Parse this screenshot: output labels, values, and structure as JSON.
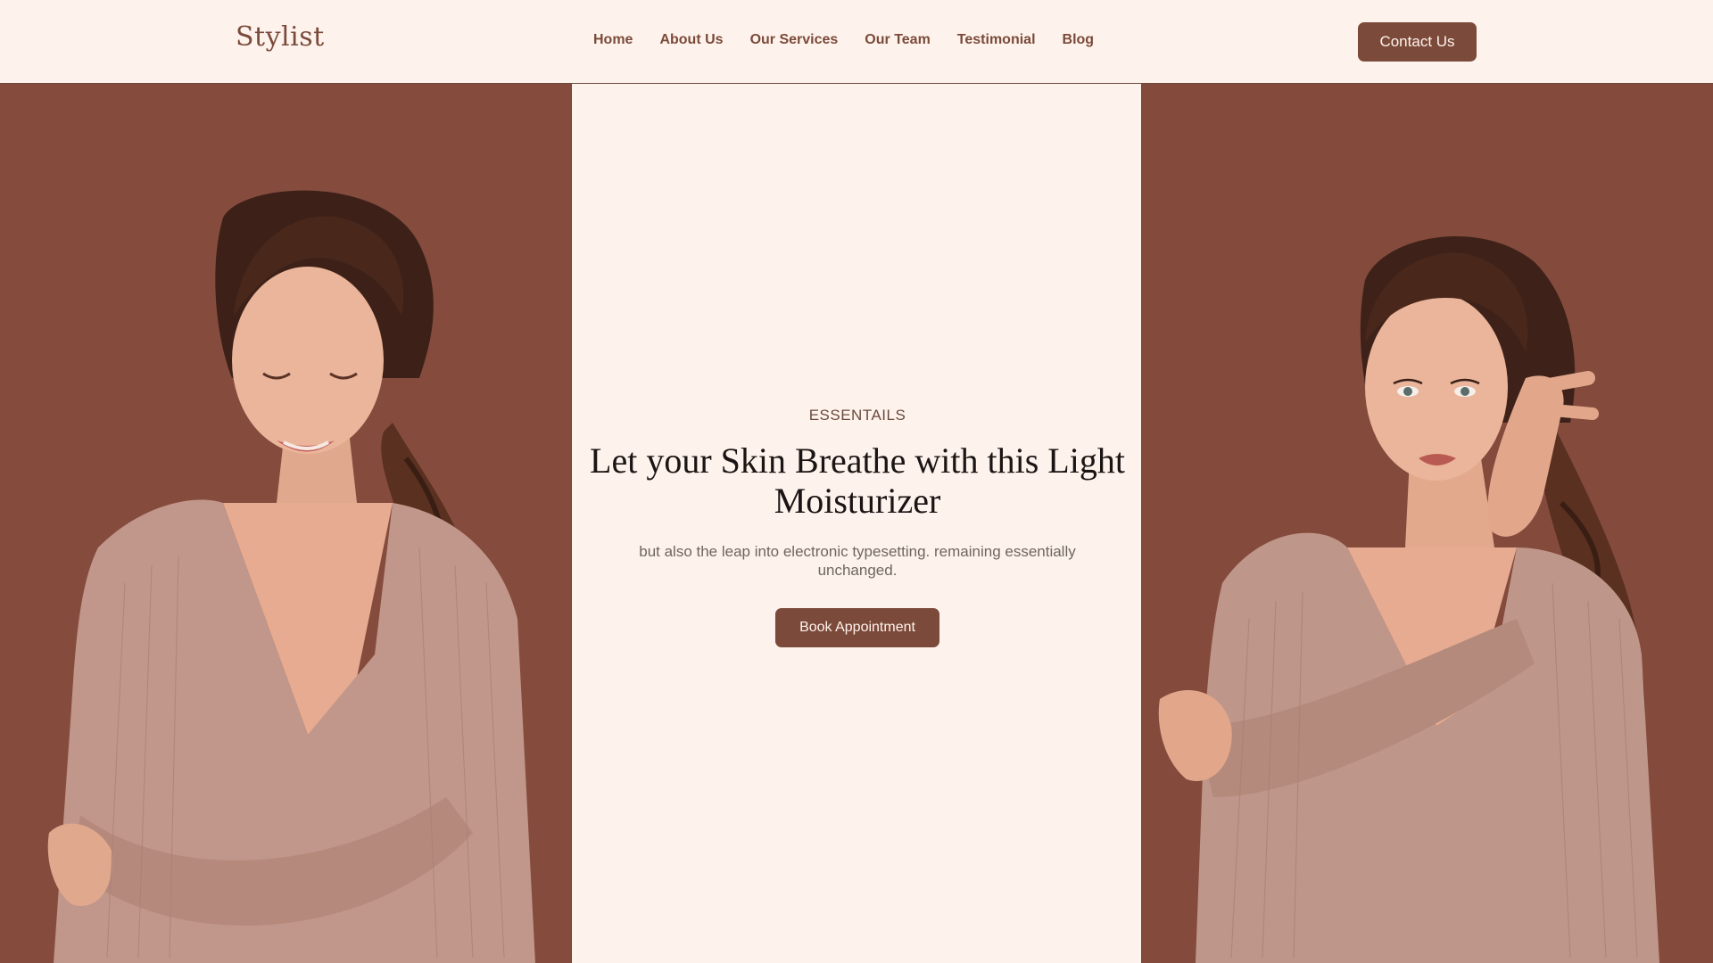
{
  "brand": {
    "logo_text": "Stylist"
  },
  "nav": {
    "items": [
      {
        "label": "Home"
      },
      {
        "label": "About Us"
      },
      {
        "label": "Our Services"
      },
      {
        "label": "Our Team"
      },
      {
        "label": "Testimonial"
      },
      {
        "label": "Blog"
      }
    ],
    "contact_label": "Contact Us"
  },
  "hero": {
    "eyebrow": "ESSENTAILS",
    "title": "Let your Skin Breathe with this Light Moisturizer",
    "subtitle": "but also the leap into electronic typesetting. remaining essentially unchanged.",
    "cta_label": "Book Appointment"
  },
  "images": {
    "left": "model-portrait-smiling",
    "right": "model-portrait-hand-on-neck"
  },
  "colors": {
    "background": "#fef3ec",
    "accent": "#7c4a3a",
    "backdrop": "#844c3e",
    "heading": "#1a1414",
    "body_text": "#6e6660"
  }
}
